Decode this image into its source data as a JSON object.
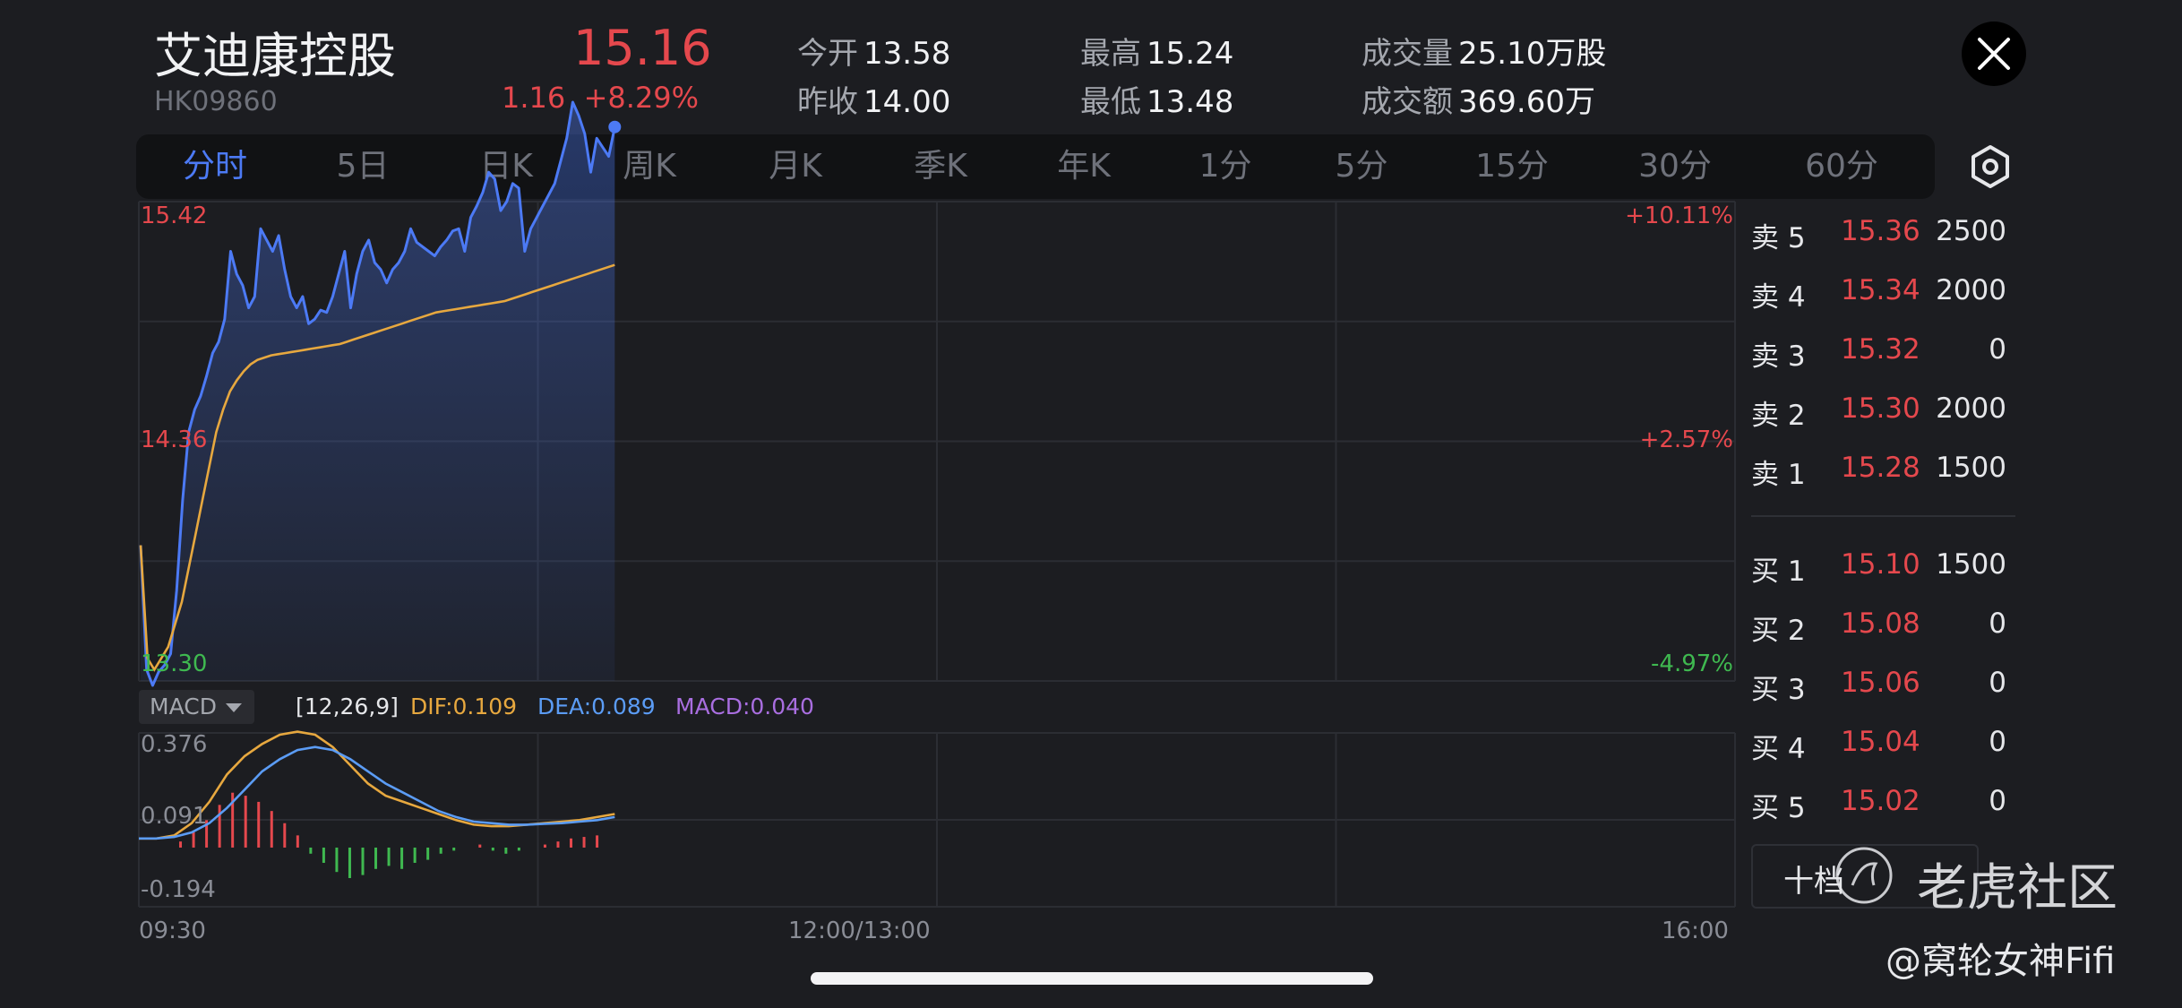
{
  "header": {
    "name": "艾迪康控股",
    "code": "HK09860",
    "price": "15.16",
    "change_abs": "1.16",
    "change_pct": "+8.29%",
    "open_label": "今开",
    "open": "13.58",
    "prev_close_label": "昨收",
    "prev_close": "14.00",
    "high_label": "最高",
    "high": "15.24",
    "low_label": "最低",
    "low": "13.48",
    "volume_label": "成交量",
    "volume": "25.10万股",
    "turnover_label": "成交额",
    "turnover": "369.60万"
  },
  "tabs": [
    "分时",
    "5日",
    "日K",
    "周K",
    "月K",
    "季K",
    "年K",
    "1分",
    "5分",
    "15分",
    "30分",
    "60分"
  ],
  "active_tab": 0,
  "axis": {
    "price_top": "15.42",
    "price_mid": "14.36",
    "price_bottom": "13.30",
    "pct_top": "+10.11%",
    "pct_mid": "+2.57%",
    "pct_bottom": "-4.97%",
    "time_start": "09:30",
    "time_mid": "12:00/13:00",
    "time_end": "16:00"
  },
  "macd": {
    "selector": "MACD",
    "params": "[12,26,9]",
    "dif": "DIF:0.109",
    "dea": "DEA:0.089",
    "macd": "MACD:0.040",
    "y_top": "0.376",
    "y_mid": "0.091",
    "y_bottom": "-0.194"
  },
  "order_book": {
    "asks": [
      {
        "label": "卖 5",
        "price": "15.36",
        "vol": "2500"
      },
      {
        "label": "卖 4",
        "price": "15.34",
        "vol": "2000"
      },
      {
        "label": "卖 3",
        "price": "15.32",
        "vol": "0"
      },
      {
        "label": "卖 2",
        "price": "15.30",
        "vol": "2000"
      },
      {
        "label": "卖 1",
        "price": "15.28",
        "vol": "1500"
      }
    ],
    "bids": [
      {
        "label": "买 1",
        "price": "15.10",
        "vol": "1500"
      },
      {
        "label": "买 2",
        "price": "15.08",
        "vol": "0"
      },
      {
        "label": "买 3",
        "price": "15.06",
        "vol": "0"
      },
      {
        "label": "买 4",
        "price": "15.04",
        "vol": "0"
      },
      {
        "label": "买 5",
        "price": "15.02",
        "vol": "0"
      }
    ],
    "depth_button": "十档"
  },
  "watermark": {
    "brand": "老虎社区",
    "author": "@窝轮女神Fifi"
  },
  "colors": {
    "up": "#e5484d",
    "down": "#3fb950",
    "price_line": "#4c7af5",
    "avg_line": "#e7a83f",
    "dea_line": "#5b9cf5",
    "macd_label": "#a96ee0",
    "background": "#1c1d21"
  },
  "chart_data": {
    "type": "line",
    "x_range": [
      "09:30",
      "16:00"
    ],
    "ylim": [
      13.3,
      15.42
    ],
    "series": [
      {
        "values": [
          13.9,
          13.35,
          13.28,
          13.34,
          13.37,
          13.42,
          13.7,
          14.1,
          14.4,
          14.5,
          14.56,
          14.65,
          14.75,
          14.8,
          14.9,
          15.2,
          15.1,
          15.05,
          14.95,
          15.0,
          15.3,
          15.25,
          15.2,
          15.27,
          15.12,
          15.0,
          14.95,
          15.0,
          14.88,
          14.9,
          14.94,
          14.93,
          15.0,
          15.1,
          15.2,
          14.95,
          15.1,
          15.2,
          15.25,
          15.15,
          15.12,
          15.06,
          15.12,
          15.15,
          15.2,
          15.3,
          15.24,
          15.22,
          15.2,
          15.18,
          15.22,
          15.25,
          15.29,
          15.3,
          15.2,
          15.35,
          15.4,
          15.46,
          15.55,
          15.52,
          15.38,
          15.42,
          15.5,
          15.48,
          15.2,
          15.3,
          15.35,
          15.4,
          15.45,
          15.5,
          15.6,
          15.7,
          15.86,
          15.8,
          15.72,
          15.55,
          15.7,
          15.66,
          15.62,
          15.75
        ]
      },
      {
        "values": [
          13.9,
          13.4,
          13.35,
          13.4,
          13.45,
          13.55,
          13.65,
          13.8,
          13.95,
          14.1,
          14.25,
          14.4,
          14.5,
          14.58,
          14.63,
          14.67,
          14.7,
          14.72,
          14.73,
          14.74,
          14.745,
          14.75,
          14.755,
          14.76,
          14.765,
          14.77,
          14.775,
          14.78,
          14.785,
          14.79,
          14.8,
          14.81,
          14.82,
          14.83,
          14.84,
          14.85,
          14.86,
          14.87,
          14.88,
          14.89,
          14.9,
          14.91,
          14.92,
          14.93,
          14.935,
          14.94,
          14.945,
          14.95,
          14.955,
          14.96,
          14.965,
          14.97,
          14.975,
          14.98,
          14.99,
          15.0,
          15.01,
          15.02,
          15.03,
          15.04,
          15.05,
          15.06,
          15.07,
          15.08,
          15.09,
          15.1,
          15.11,
          15.12,
          15.13,
          15.14
        ]
      }
    ],
    "macd": {
      "ylim": [
        -0.194,
        0.376
      ],
      "dif": [
        0.03,
        0.03,
        0.04,
        0.08,
        0.15,
        0.24,
        0.3,
        0.34,
        0.37,
        0.38,
        0.37,
        0.33,
        0.27,
        0.21,
        0.17,
        0.15,
        0.13,
        0.11,
        0.09,
        0.075,
        0.07,
        0.07,
        0.075,
        0.08,
        0.085,
        0.09,
        0.1,
        0.11
      ],
      "dea": [
        0.03,
        0.03,
        0.035,
        0.05,
        0.08,
        0.13,
        0.19,
        0.25,
        0.29,
        0.32,
        0.33,
        0.32,
        0.29,
        0.25,
        0.21,
        0.18,
        0.15,
        0.12,
        0.1,
        0.085,
        0.08,
        0.075,
        0.075,
        0.078,
        0.08,
        0.085,
        0.09,
        0.1
      ],
      "hist": [
        0,
        0.02,
        0.05,
        0.09,
        0.14,
        0.18,
        0.17,
        0.15,
        0.12,
        0.08,
        0.04,
        -0.02,
        -0.05,
        -0.08,
        -0.1,
        -0.09,
        -0.07,
        -0.06,
        -0.07,
        -0.05,
        -0.04,
        -0.02,
        -0.01,
        0.0,
        0.01,
        -0.01,
        -0.02,
        -0.01,
        0.0,
        0.01,
        0.02,
        0.03,
        0.035,
        0.04
      ]
    }
  }
}
